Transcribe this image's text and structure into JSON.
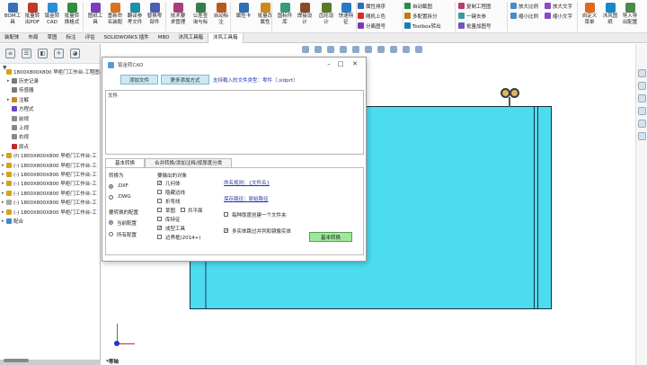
{
  "ribbon": {
    "large": [
      {
        "label": "BOM工\n具",
        "color": "#3a6fb8"
      },
      {
        "label": "批量转\n出PDF",
        "color": "#c0392b"
      },
      {
        "label": "钣金转\nCAD",
        "color": "#2b8dd8"
      },
      {
        "label": "批量转\n换格式",
        "color": "#2f8f3f"
      },
      {
        "label": "图纸工\n具",
        "color": "#7d3cb8"
      },
      {
        "label": "重新命\n名装配",
        "color": "#d6751f"
      },
      {
        "label": "翻译参\n考文件",
        "color": "#1f8fa6"
      },
      {
        "label": "替换零\n部件",
        "color": "#4d5fb3"
      },
      {
        "label": "技术要\n求管理",
        "color": "#a6427a"
      },
      {
        "label": "公差查\n询与标",
        "color": "#367d4a"
      },
      {
        "label": "自动标\n注",
        "color": "#b85a1f"
      },
      {
        "label": "属性卡",
        "color": "#2f6fb3"
      },
      {
        "label": "批量改\n属性",
        "color": "#c78c1a"
      },
      {
        "label": "国标件\n库",
        "color": "#3a9a7a"
      },
      {
        "label": "焊接设\n计",
        "color": "#8a4a2a"
      },
      {
        "label": "齿轮设\n计",
        "color": "#5a7a2a"
      },
      {
        "label": "快速特\n征",
        "color": "#2a7ac0"
      },
      {
        "label": "自定义\n菜单",
        "color": "#e06a1a"
      },
      {
        "label": "沐风图\n纸",
        "color": "#1a86c8"
      },
      {
        "label": "导入导\n出配置",
        "color": "#4a8a4a"
      }
    ],
    "small": [
      {
        "label": "属性排序",
        "color": "#2a6fb8"
      },
      {
        "label": "随机上色",
        "color": "#d0302a"
      },
      {
        "label": "分离图号",
        "color": "#7a3ab8"
      },
      {
        "label": "自动截图",
        "color": "#2a8a4a"
      },
      {
        "label": "多配置拆分",
        "color": "#c07a1a"
      },
      {
        "label": "Toolbox转出",
        "color": "#1a7ab8"
      },
      {
        "label": "复制工程图",
        "color": "#b83a6a"
      },
      {
        "label": "一键去参",
        "color": "#3a9a9a"
      },
      {
        "label": "批量加图号",
        "color": "#6a5ab8"
      },
      {
        "label": "放大比例",
        "color": "#4a8ac8"
      },
      {
        "label": "缩小比例",
        "color": "#4a8ac8"
      },
      {
        "label": "放大文字",
        "color": "#8a4ac8"
      },
      {
        "label": "缩小文字",
        "color": "#8a4ac8"
      }
    ]
  },
  "tabs": [
    "装配体",
    "布局",
    "草图",
    "标注",
    "评估",
    "SOLIDWORKS 插件",
    "MBD",
    "沐风工具箱",
    "沐风工具箱"
  ],
  "tree": {
    "items": [
      {
        "text": "1800X800X800 早柜门工作台-工程图-组",
        "ex": "",
        "color": "#d6a21a"
      },
      {
        "text": "历史记录",
        "ex": "▸",
        "color": "#7a7a7a"
      },
      {
        "text": "传感器",
        "ex": "",
        "color": "#7a7a7a"
      },
      {
        "text": "注解",
        "ex": "▸",
        "color": "#c98a1a"
      },
      {
        "text": "方程式",
        "ex": "",
        "color": "#6a4ab8"
      },
      {
        "text": "前视",
        "ex": "",
        "color": "#8a8a8a"
      },
      {
        "text": "上视",
        "ex": "",
        "color": "#8a8a8a"
      },
      {
        "text": "右视",
        "ex": "",
        "color": "#8a8a8a"
      },
      {
        "text": "原点",
        "ex": "",
        "color": "#c02a2a"
      },
      {
        "text": "(f) 1800X800X800 早柜门工作台-工",
        "ex": "▸",
        "color": "#d6a21a"
      },
      {
        "text": "(-) 1800X800X800 早柜门工作台-工",
        "ex": "▸",
        "color": "#d6a21a"
      },
      {
        "text": "(-) 1800X800X800 早柜门工作台-工",
        "ex": "▸",
        "color": "#d6a21a"
      },
      {
        "text": "(-) 1800X800X800 早柜门工作台-工",
        "ex": "▸",
        "color": "#d6a21a"
      },
      {
        "text": "(-) 1800X800X800 早柜门工作台-工",
        "ex": "▸",
        "color": "#d6a21a"
      },
      {
        "text": "(-) 1800X800X800 早柜门工作台-工",
        "ex": "▸",
        "color": "#aaaaaa"
      },
      {
        "text": "(-) 1800X800X800 早柜门工作台-工",
        "ex": "▸",
        "color": "#d6a21a"
      },
      {
        "text": "配合",
        "ex": "▸",
        "color": "#3a8ac8"
      }
    ]
  },
  "viewport": {
    "iso_label": "*等轴"
  },
  "dialog": {
    "title": "钣金转CAD",
    "add_file": "添加文件",
    "add_more": "更多添加方式",
    "supported_types": "支持载入的文件类型：零件（.sldprt）",
    "file_header": "文件",
    "tab_basic": "基本转换",
    "tab_merge": "合并转换/添加注释/按厚度分类",
    "format_label": "转换为",
    "format_dxf": ".DXF",
    "format_dwg": ".DWG",
    "config_label": "要转换的配置",
    "config_current": "当前配置",
    "config_all": "所有配置",
    "output_label": "要输出的对象",
    "out_geometry": "几何体",
    "out_hidden_edges": "隐藏边线",
    "out_bend_lines": "折弯线",
    "out_sketch": "草图",
    "out_library_feature": "库特征",
    "out_forming_tool": "成型工具",
    "out_boundary_box": "边界框(2014+)",
    "out_coplanar": "共平面",
    "naming_rule": "命名规则：{文件名}",
    "save_path": "保存路径：原始路径",
    "per_thickness_folder": "每种厚度创建一个文件夹",
    "skip_multibody": "多实体跳过并列和镜像实体",
    "convert_button": "基本转换"
  }
}
